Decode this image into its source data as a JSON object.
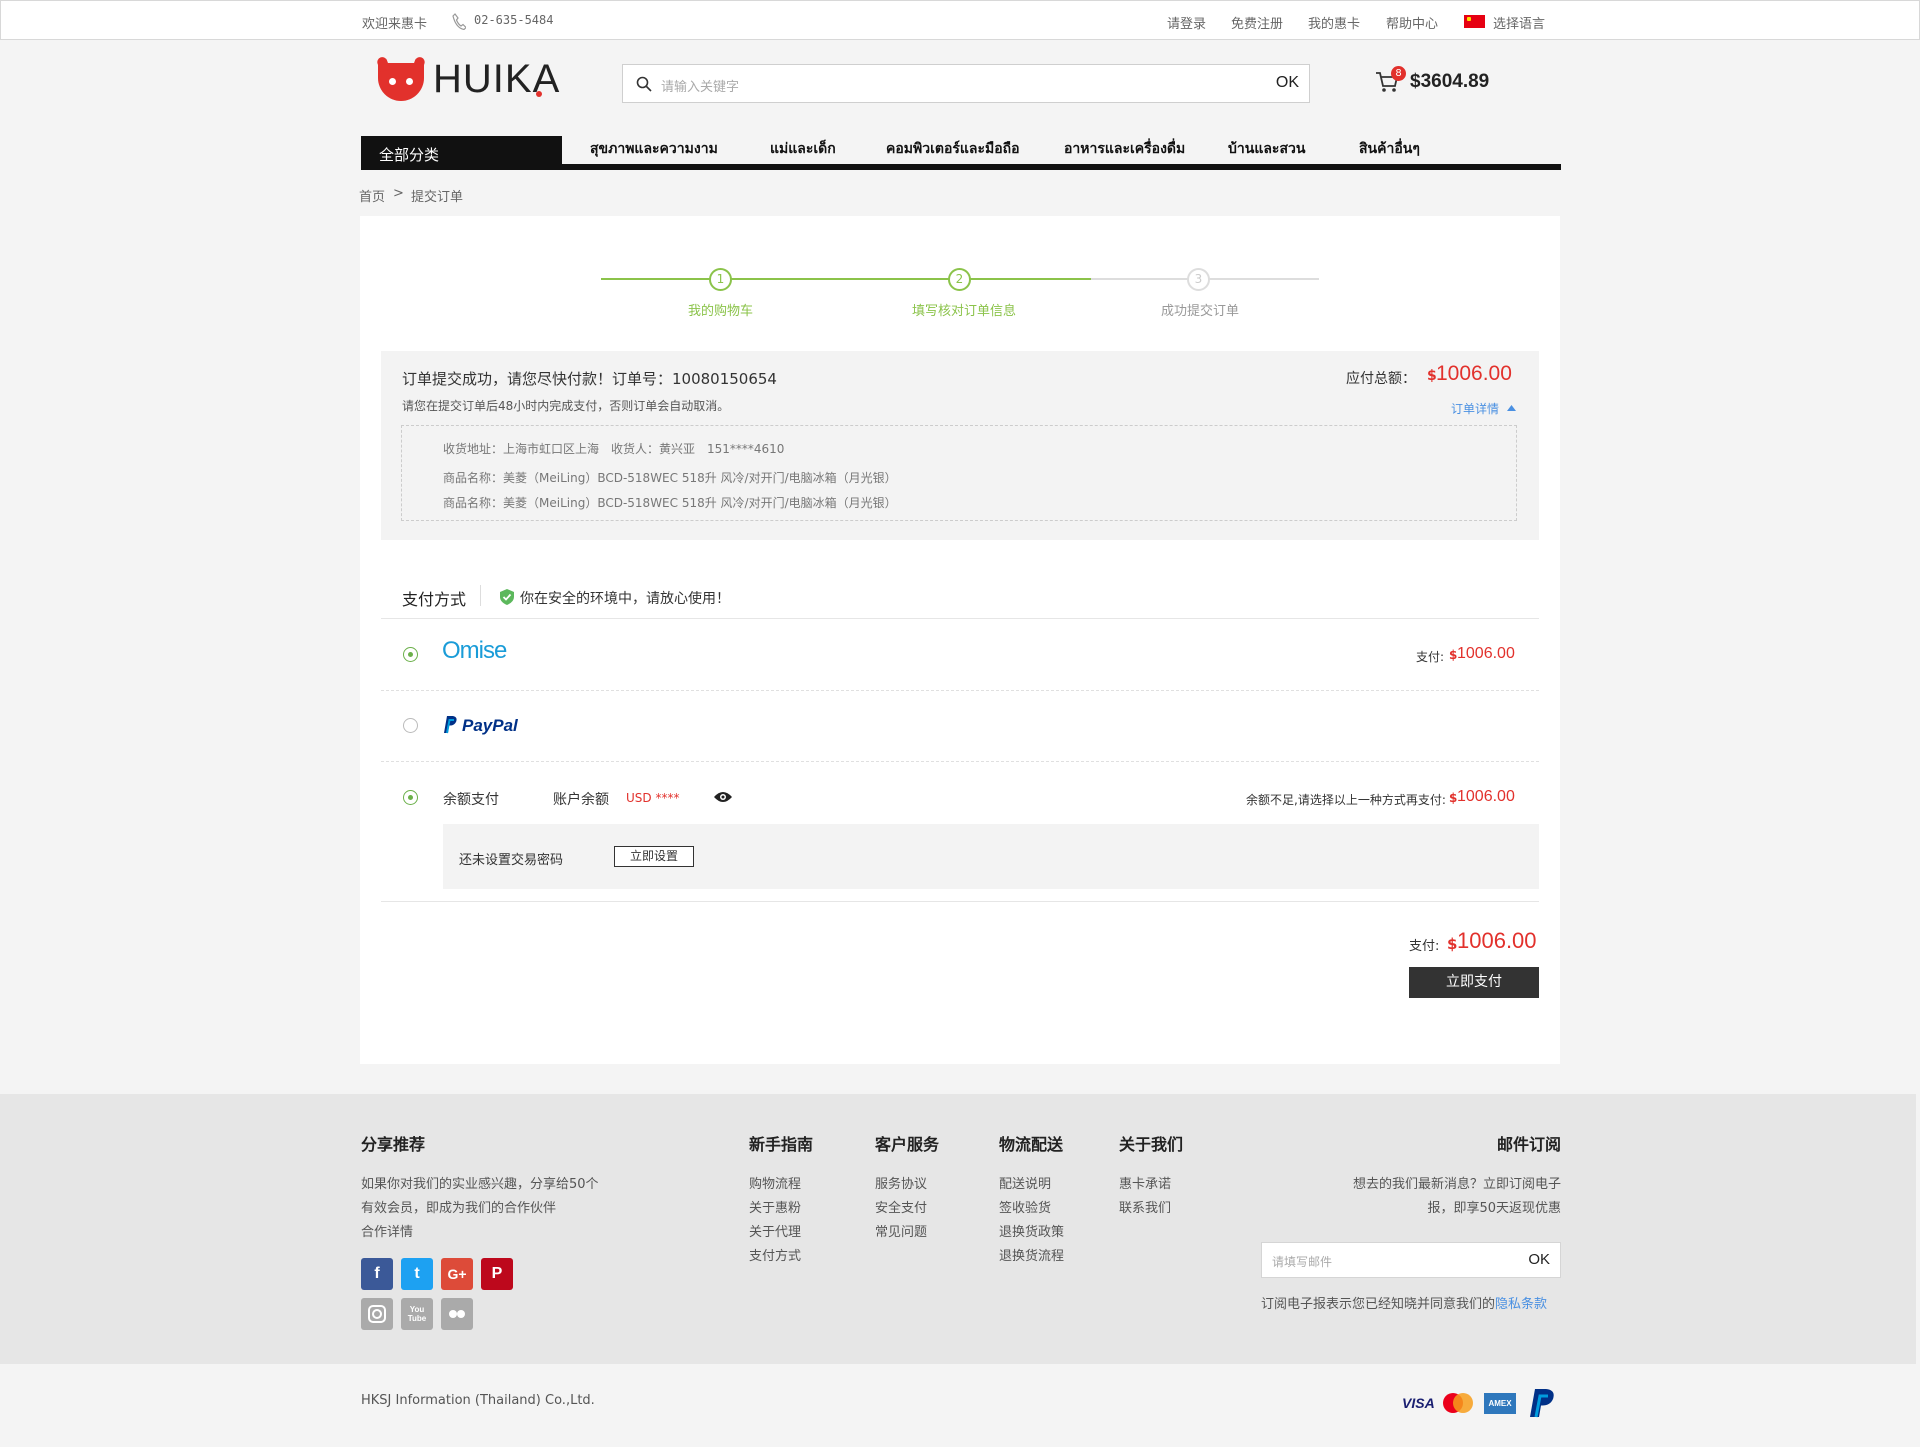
{
  "topbar": {
    "welcome": "欢迎来惠卡",
    "phone": "02-635-5484",
    "login": "请登录",
    "register": "免费注册",
    "my_account": "我的惠卡",
    "help": "帮助中心",
    "language": "选择语言"
  },
  "header": {
    "logo_text": "HUIKA",
    "search_placeholder": "请输入关键字",
    "search_button": "OK",
    "cart_count": "8",
    "cart_total": "$3604.89"
  },
  "nav": {
    "all_categories": "全部分类",
    "items": [
      "สุขภาพและความงาม",
      "แม่และเด็ก",
      "คอมพิวเตอร์และมือถือ",
      "อาหารและเครื่องดื่ม",
      "บ้านและสวน",
      "สินค้าอื่นๆ"
    ]
  },
  "breadcrumb": {
    "home": "首页",
    "sep": ">",
    "current": "提交订单"
  },
  "steps": [
    {
      "num": "1",
      "label": "我的购物车"
    },
    {
      "num": "2",
      "label": "填写核对订单信息"
    },
    {
      "num": "3",
      "label": "成功提交订单"
    }
  ],
  "order": {
    "success_msg": "订单提交成功，请您尽快付款！订单号：10080150654",
    "notice": "请您在提交订单后48小时内完成支付，否则订单会自动取消。",
    "total_label": "应付总额：",
    "total_currency": "$",
    "total_amount": "1006.00",
    "detail_link": "订单详情",
    "address": "收货地址：上海市虹口区上海　收货人：黄兴亚　151****4610",
    "products": [
      "商品名称：美菱（MeiLing）BCD-518WEC 518升 风冷/对开门/电脑冰箱（月光银）",
      "商品名称：美菱（MeiLing）BCD-518WEC 518升 风冷/对开门/电脑冰箱（月光银）"
    ]
  },
  "payment": {
    "title": "支付方式",
    "secure_msg": "你在安全的环境中，请放心使用！",
    "omise": {
      "logo": "Omise",
      "pay_label": "支付:",
      "currency": "$",
      "amount": "1006.00"
    },
    "paypal": {
      "logo": "PayPal"
    },
    "balance": {
      "label": "余额支付",
      "account_label": "账户余额",
      "account_value": "USD ****",
      "insufficient": "余额不足,请选择以上一种方式再支付:",
      "currency": "$",
      "amount": "1006.00"
    },
    "no_password": "还未设置交易密码",
    "set_now": "立即设置",
    "final_label": "支付:",
    "final_currency": "$",
    "final_amount": "1006.00",
    "pay_now": "立即支付"
  },
  "footer": {
    "share_title": "分享推荐",
    "share_lines": [
      "如果你对我们的实业感兴趣，分享给50个",
      "有效会员，即成为我们的合作伙伴",
      "合作详情"
    ],
    "columns": [
      {
        "title": "新手指南",
        "links": [
          "购物流程",
          "关于惠粉",
          "关于代理",
          "支付方式"
        ]
      },
      {
        "title": "客户服务",
        "links": [
          "服务协议",
          "安全支付",
          "常见问题"
        ]
      },
      {
        "title": "物流配送",
        "links": [
          "配送说明",
          "签收验货",
          "退换货政策",
          "退换货流程"
        ]
      },
      {
        "title": "关于我们",
        "links": [
          "惠卡承诺",
          "联系我们"
        ]
      }
    ],
    "subscribe_title": "邮件订阅",
    "subscribe_lines": [
      "想去的我们最新消息？立即订阅电子",
      "报，即享50天返现优惠"
    ],
    "email_placeholder": "请填写邮件",
    "email_button": "OK",
    "privacy_text": "订阅电子报表示您已经知晓并同意我们的",
    "privacy_link": "隐私条款",
    "social": {
      "facebook": "f",
      "twitter": "t",
      "googleplus": "G+",
      "pinterest": "P",
      "youtube": "You Tube"
    },
    "copyright": "HKSJ Information (Thailand) Co.,Ltd.",
    "cards": {
      "visa": "VISA",
      "amex": "AMEX"
    }
  },
  "colors": {
    "accent_red": "#e2312c",
    "step_green": "#8bc34a",
    "link_blue": "#4a90e2"
  }
}
